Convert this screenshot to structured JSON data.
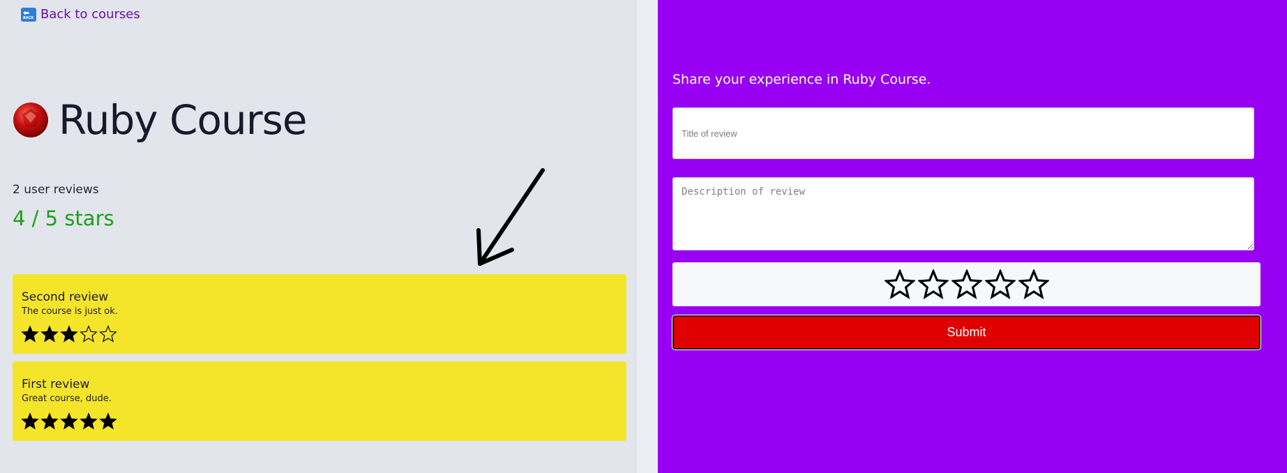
{
  "nav": {
    "back_label": "Back to courses",
    "back_icon_text": "BACK"
  },
  "course": {
    "title": "Ruby Course",
    "review_count": "2 user reviews",
    "average_rating": "4 / 5 stars"
  },
  "reviews": [
    {
      "title": "Second review",
      "description": "The course is just ok.",
      "rating": 3,
      "max": 5
    },
    {
      "title": "First review",
      "description": "Great course, dude.",
      "rating": 5,
      "max": 5
    }
  ],
  "form": {
    "heading": "Share your experience in Ruby Course.",
    "title_placeholder": "Title of review",
    "description_placeholder": "Description of review",
    "rating_selected": 0,
    "rating_max": 5,
    "submit_label": "Submit"
  },
  "colors": {
    "right_bg": "#9700f3",
    "review_card": "#f5e52a",
    "submit": "#e00000",
    "rating_text": "#17a21a",
    "link": "#6a0fa5"
  },
  "icons": {
    "back": "back-arrow-icon",
    "ruby": "ruby-gem-icon",
    "star": "star-icon"
  }
}
